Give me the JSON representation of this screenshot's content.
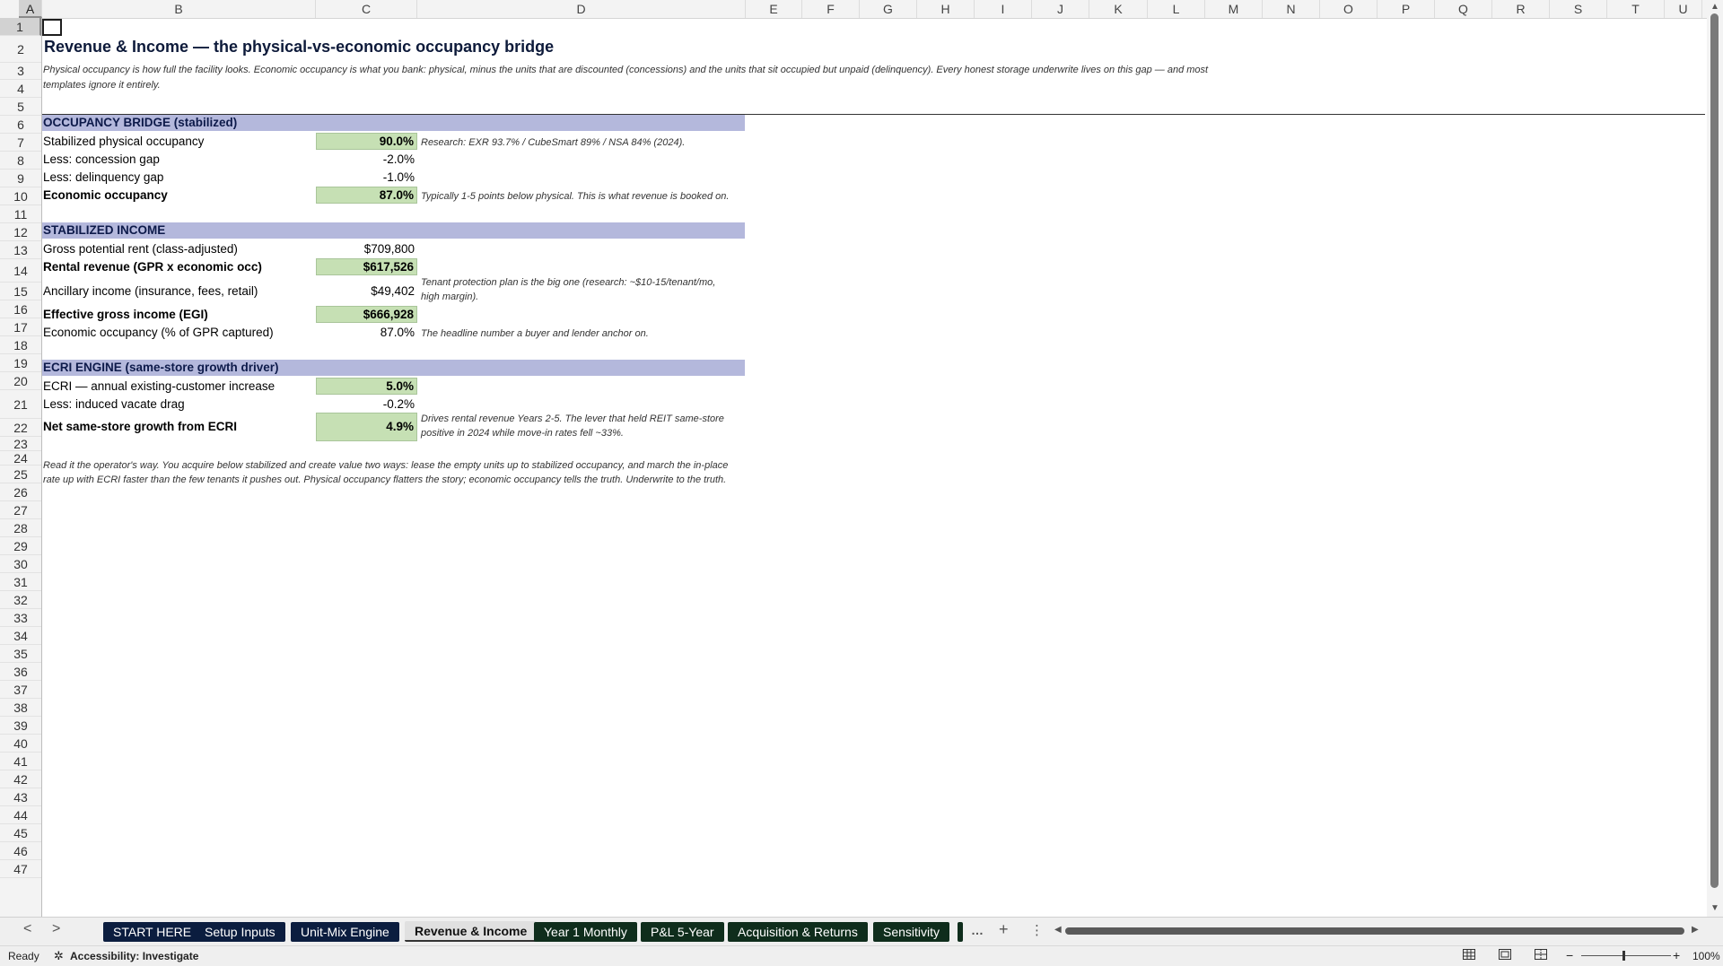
{
  "columns": [
    "A",
    "B",
    "C",
    "D",
    "E",
    "F",
    "G",
    "H",
    "I",
    "J",
    "K",
    "L",
    "M",
    "N",
    "O",
    "P",
    "Q",
    "R",
    "S",
    "T",
    "U"
  ],
  "rows": [
    "1",
    "2",
    "3",
    "4",
    "5",
    "6",
    "7",
    "8",
    "9",
    "10",
    "11",
    "12",
    "13",
    "14",
    "15",
    "16",
    "17",
    "18",
    "19",
    "20",
    "21",
    "22",
    "23",
    "24",
    "25",
    "26",
    "27",
    "28",
    "29",
    "30",
    "31",
    "32",
    "33",
    "34",
    "35",
    "36",
    "37",
    "38",
    "39",
    "40",
    "41",
    "42",
    "43",
    "44",
    "45",
    "46",
    "47"
  ],
  "sheet": {
    "title": "Revenue & Income — the physical-vs-economic occupancy bridge",
    "intro_line1": "Physical occupancy is how full the facility looks. Economic occupancy is what you bank: physical, minus the units that are discounted (concessions) and the units that sit occupied but unpaid (delinquency). Every honest storage underwrite lives on this gap — and most",
    "intro_line2": "templates ignore it entirely.",
    "bridge": {
      "header": "OCCUPANCY BRIDGE (stabilized)",
      "physical_label": "Stabilized physical occupancy",
      "physical_value": "90.0%",
      "physical_note": "Research: EXR 93.7% / CubeSmart 89% / NSA 84% (2024).",
      "concession_label": "Less: concession gap",
      "concession_value": "-2.0%",
      "delinquency_label": "Less: delinquency gap",
      "delinquency_value": "-1.0%",
      "economic_label": "Economic occupancy",
      "economic_value": "87.0%",
      "economic_note": "Typically 1-5 points below physical. This is what revenue is booked on."
    },
    "income": {
      "header": "STABILIZED INCOME",
      "gpr_label": "Gross potential rent (class-adjusted)",
      "gpr_value": "$709,800",
      "rental_label": "Rental revenue (GPR x economic occ)",
      "rental_value": "$617,526",
      "ancillary_label": "Ancillary income (insurance, fees, retail)",
      "ancillary_value": "$49,402",
      "ancillary_note1": "Tenant protection plan is the big one (research: ~$10-15/tenant/mo,",
      "ancillary_note2": "high margin).",
      "egi_label": "Effective gross income (EGI)",
      "egi_value": "$666,928",
      "econ_pct_label": "Economic occupancy (% of GPR captured)",
      "econ_pct_value": "87.0%",
      "econ_pct_note": "The headline number a buyer and lender anchor on."
    },
    "ecri": {
      "header": "ECRI ENGINE (same-store growth driver)",
      "increase_label": "ECRI — annual existing-customer increase",
      "increase_value": "5.0%",
      "drag_label": "Less: induced vacate drag",
      "drag_value": "-0.2%",
      "net_label": "Net same-store growth from ECRI",
      "net_value": "4.9%",
      "net_note1": "Drives rental revenue Years 2-5. The lever that held REIT same-store",
      "net_note2": "positive in 2024 while move-in rates fell ~33%."
    },
    "closing_line1": "Read it the operator's way. You acquire below stabilized and create value two ways: lease the empty units up to stabilized occupancy, and march the in-place",
    "closing_line2": "rate up with ECRI faster than the few tenants it pushes out. Physical occupancy flatters the story; economic occupancy tells the truth. Underwrite to the truth."
  },
  "tabs": [
    {
      "label": "START HERE",
      "style": "navy"
    },
    {
      "label": "Setup Inputs",
      "style": "navy"
    },
    {
      "label": "Unit-Mix Engine",
      "style": "navy"
    },
    {
      "label": "Revenue & Income",
      "style": "active"
    },
    {
      "label": "Year 1 Monthly",
      "style": "green"
    },
    {
      "label": "P&L 5-Year",
      "style": "green"
    },
    {
      "label": "Acquisition & Returns",
      "style": "green"
    },
    {
      "label": "Sensitivity",
      "style": "green"
    }
  ],
  "tabbar": {
    "prev_icon": "<",
    "next_icon": ">",
    "more_icon": "…",
    "add_icon": "+",
    "options_icon": "⋮"
  },
  "status": {
    "ready": "Ready",
    "accessibility": "Accessibility: Investigate",
    "zoom": "100%",
    "zoom_minus": "−",
    "zoom_plus": "+"
  }
}
